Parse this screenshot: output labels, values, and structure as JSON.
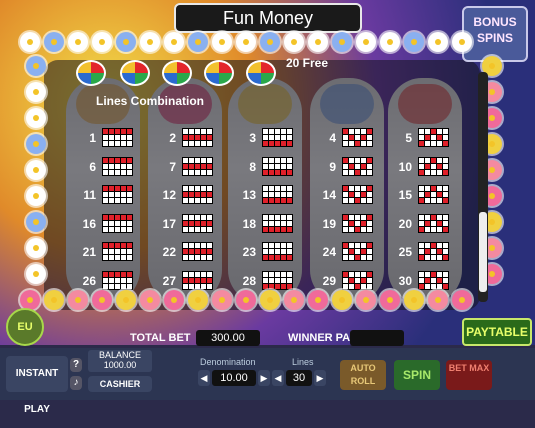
{
  "title": "Fun Money",
  "bonus_sign": "BONUS SPINS",
  "free_spins_label": "20 Free",
  "heading": "Lines Combination",
  "lines": [
    {
      "n": "1"
    },
    {
      "n": "2"
    },
    {
      "n": "3"
    },
    {
      "n": "4"
    },
    {
      "n": "5"
    },
    {
      "n": "6"
    },
    {
      "n": "7"
    },
    {
      "n": "8"
    },
    {
      "n": "9"
    },
    {
      "n": "10"
    },
    {
      "n": "11"
    },
    {
      "n": "12"
    },
    {
      "n": "13"
    },
    {
      "n": "14"
    },
    {
      "n": "15"
    },
    {
      "n": "16"
    },
    {
      "n": "17"
    },
    {
      "n": "18"
    },
    {
      "n": "19"
    },
    {
      "n": "20"
    },
    {
      "n": "21"
    },
    {
      "n": "22"
    },
    {
      "n": "23"
    },
    {
      "n": "24"
    },
    {
      "n": "25"
    },
    {
      "n": "26"
    },
    {
      "n": "27"
    },
    {
      "n": "28"
    },
    {
      "n": "29"
    },
    {
      "n": "30"
    }
  ],
  "patterns": [
    [
      [
        0,
        1,
        1,
        1,
        1,
        1
      ],
      [
        1,
        0,
        0,
        0,
        0,
        0
      ],
      [
        2,
        0,
        0,
        0,
        0,
        0
      ]
    ],
    [
      [
        0,
        0,
        0,
        0,
        0,
        0
      ],
      [
        1,
        1,
        1,
        1,
        1,
        1
      ],
      [
        2,
        0,
        0,
        0,
        0,
        0
      ]
    ],
    [
      [
        0,
        0,
        0,
        0,
        0,
        0
      ],
      [
        1,
        0,
        0,
        0,
        0,
        0
      ],
      [
        2,
        1,
        1,
        1,
        1,
        1
      ]
    ],
    [
      [
        0,
        1,
        0,
        0,
        0,
        1
      ],
      [
        1,
        0,
        1,
        0,
        1,
        0
      ],
      [
        2,
        0,
        0,
        1,
        0,
        0
      ]
    ],
    [
      [
        0,
        0,
        0,
        1,
        0,
        0
      ],
      [
        1,
        0,
        1,
        0,
        1,
        0
      ],
      [
        2,
        1,
        0,
        0,
        0,
        1
      ]
    ]
  ],
  "paytable_label": "PAYTABLE",
  "eu_label": "EU",
  "total_bet_label": "TOTAL BET",
  "total_bet_value": "300.00",
  "winner_paid_label": "WINNER PAID",
  "instant_play_label": "INSTANT PLAY",
  "help_label": "?",
  "balance_label": "BALANCE",
  "balance_value": "1000.00",
  "cashier_label": "CASHIER",
  "denomination_label": "Denomination",
  "denomination_value": "10.00",
  "lines_label": "Lines",
  "lines_value": "30",
  "auto_roll_label": "AUTO ROLL",
  "spin_label": "SPIN",
  "bet_max_label": "BET MAX",
  "colors": {
    "active_cell": "#e0202a",
    "inactive_cell": "#ffffff",
    "paytable_text": "#e8ff6a"
  },
  "scroll_position": 0.6
}
